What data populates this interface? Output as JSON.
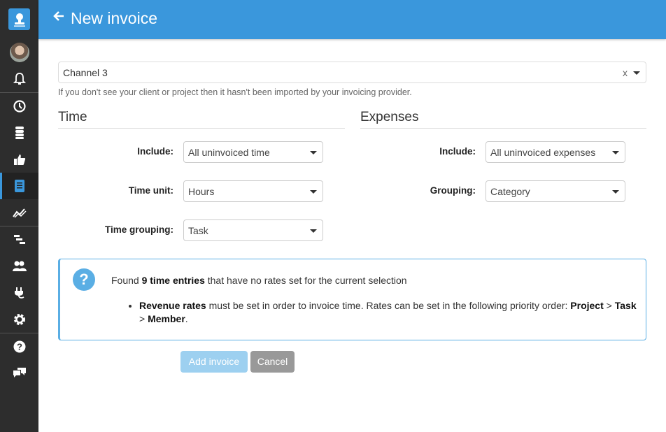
{
  "header": {
    "title": "New invoice",
    "back_icon": "arrow-left-icon"
  },
  "sidebar": {
    "items": [
      {
        "name": "notifications",
        "icon": "bell-icon"
      },
      {
        "name": "timer",
        "icon": "clock-icon"
      },
      {
        "name": "database",
        "icon": "database-icon"
      },
      {
        "name": "approvals",
        "icon": "thumbs-up-icon"
      },
      {
        "name": "invoices",
        "icon": "invoice-icon",
        "active": true
      },
      {
        "name": "reports",
        "icon": "chart-line-icon"
      },
      {
        "name": "planning",
        "icon": "gantt-icon"
      },
      {
        "name": "team",
        "icon": "users-icon"
      },
      {
        "name": "integrations",
        "icon": "plug-icon"
      },
      {
        "name": "settings",
        "icon": "gear-icon"
      },
      {
        "name": "help",
        "icon": "question-icon"
      },
      {
        "name": "feedback",
        "icon": "chat-icon"
      }
    ]
  },
  "client": {
    "value": "Channel 3",
    "clear_label": "x",
    "hint": "If you don't see your client or project then it hasn't been imported by your invoicing provider."
  },
  "time": {
    "title": "Time",
    "fields": [
      {
        "label": "Include:",
        "value": "All uninvoiced time"
      },
      {
        "label": "Time unit:",
        "value": "Hours"
      },
      {
        "label": "Time grouping:",
        "value": "Task"
      }
    ]
  },
  "expenses": {
    "title": "Expenses",
    "fields": [
      {
        "label": "Include:",
        "value": "All uninvoiced expenses"
      },
      {
        "label": "Grouping:",
        "value": "Category"
      }
    ]
  },
  "alert": {
    "prefix": "Found ",
    "count_bold": "9 time entries",
    "suffix": " that have no rates set for the current selection",
    "bullet_bold": "Revenue rates",
    "bullet_text": " must be set in order to invoice time. Rates can be set in the following priority order: ",
    "order_1": "Project",
    "sep_1": " > ",
    "order_2": "Task",
    "sep_2": " > ",
    "order_3": "Member",
    "end": "."
  },
  "buttons": {
    "add": "Add invoice",
    "cancel": "Cancel"
  },
  "colors": {
    "accent": "#3a97dc",
    "sidebar": "#2d2d2d",
    "alert_border": "#5aaee4",
    "add_disabled": "#9dd0f0",
    "cancel": "#999999"
  }
}
